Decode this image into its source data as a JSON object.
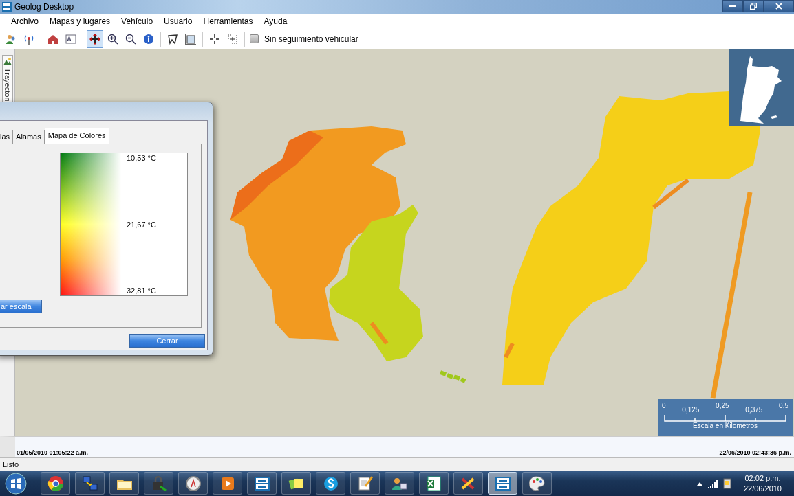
{
  "window": {
    "title": "Geolog Desktop"
  },
  "menu": [
    "Archivo",
    "Mapas y lugares",
    "Vehículo",
    "Usuario",
    "Herramientas",
    "Ayuda"
  ],
  "toolbar": {
    "tool_groups": [
      [
        {
          "kind": "users",
          "selected": false
        },
        {
          "kind": "antenna",
          "selected": false
        }
      ],
      [
        {
          "kind": "house",
          "selected": false
        },
        {
          "kind": "label",
          "selected": false
        }
      ],
      [
        {
          "kind": "move",
          "selected": true
        },
        {
          "kind": "zoomin",
          "selected": false
        },
        {
          "kind": "zoomout",
          "selected": false
        },
        {
          "kind": "info",
          "selected": false
        }
      ],
      [
        {
          "kind": "polygon",
          "selected": false
        },
        {
          "kind": "frame",
          "selected": false
        }
      ],
      [
        {
          "kind": "cross",
          "selected": false
        },
        {
          "kind": "dotcross",
          "selected": false
        }
      ]
    ],
    "tracking": {
      "label": "Sin seguimiento vehicular",
      "checked": false
    }
  },
  "side_tab": {
    "label": "Trayectori"
  },
  "dialog": {
    "tabs": [
      {
        "label": "las",
        "selected": false
      },
      {
        "label": "Alamas",
        "selected": false
      },
      {
        "label": "Mapa de Colores",
        "selected": true
      }
    ],
    "legend": [
      "10,53 °C",
      "21,67 °C",
      "32,81 °C"
    ],
    "buttons": [
      "ar escala",
      "Cerrar"
    ]
  },
  "scale": {
    "ticks": [
      "0",
      "0,125",
      "0,25",
      "0,375",
      "0,5"
    ],
    "caption": "Escala en Kilometros"
  },
  "timeline": {
    "start": "01/05/2010 01:05:22 a.m.",
    "end": "22/06/2010 02:43:36 p.m."
  },
  "status_bar": "Listo",
  "taskbar": {
    "apps": [
      {
        "kind": "browser",
        "selected": false
      },
      {
        "kind": "network",
        "selected": false
      },
      {
        "kind": "folder",
        "selected": false
      },
      {
        "kind": "lock",
        "selected": false
      },
      {
        "kind": "compass",
        "selected": false
      },
      {
        "kind": "player",
        "selected": false
      },
      {
        "kind": "logo",
        "selected": false
      },
      {
        "kind": "notes",
        "selected": false
      },
      {
        "kind": "phone",
        "selected": false
      },
      {
        "kind": "pencil",
        "selected": false
      },
      {
        "kind": "people",
        "selected": false
      },
      {
        "kind": "sheet",
        "selected": false
      },
      {
        "kind": "tools",
        "selected": false
      },
      {
        "kind": "logo",
        "selected": true
      },
      {
        "kind": "paint",
        "selected": false
      }
    ],
    "time": "02:02 p.m.",
    "date": "22/06/2010"
  }
}
